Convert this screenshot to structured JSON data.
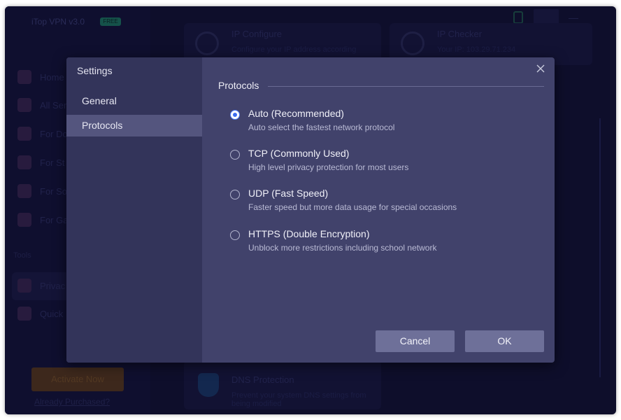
{
  "background_app": {
    "title": "iTop VPN v3.0",
    "badge": "FREE",
    "nav_items": [
      {
        "label": "Home"
      },
      {
        "label": "All Ser"
      },
      {
        "label": "For Do"
      },
      {
        "label": "For St"
      },
      {
        "label": "For So"
      },
      {
        "label": "For Ga"
      }
    ],
    "tools_label": "Tools",
    "tool_items": [
      {
        "label": "Privac"
      },
      {
        "label": "Quick"
      }
    ],
    "activate_label": "Activate Now",
    "already_purchased_label": "Already Purchased?",
    "cards": [
      {
        "title": "IP Configure",
        "subtitle": "Configure your IP address according"
      },
      {
        "title": "IP Checker",
        "subtitle": "Your IP: 103.29.71.234"
      },
      {
        "title": "DNS Protection",
        "subtitle": "Prevent your system DNS settings from being modified"
      }
    ]
  },
  "dialog": {
    "title": "Settings",
    "sidebar": [
      {
        "label": "General",
        "active": false
      },
      {
        "label": "Protocols",
        "active": true
      }
    ],
    "section_title": "Protocols",
    "options": [
      {
        "title": "Auto (Recommended)",
        "description": "Auto select the fastest network protocol",
        "selected": true
      },
      {
        "title": "TCP (Commonly Used)",
        "description": "High level privacy protection for most users",
        "selected": false
      },
      {
        "title": "UDP (Fast Speed)",
        "description": "Faster speed but more data usage for special occasions",
        "selected": false
      },
      {
        "title": "HTTPS (Double Encryption)",
        "description": "Unblock more restrictions including school network",
        "selected": false
      }
    ],
    "cancel_label": "Cancel",
    "ok_label": "OK"
  },
  "icons": {
    "close": "close-icon",
    "radio_selected": "radio-selected",
    "radio_unselected": "radio-unselected"
  },
  "colors": {
    "dialog_bg": "#41426b",
    "sidebar_bg": "#33345a",
    "active_item_bg": "#54557e",
    "button_bg": "#6e7099",
    "radio_accent": "#3b6cf0"
  }
}
